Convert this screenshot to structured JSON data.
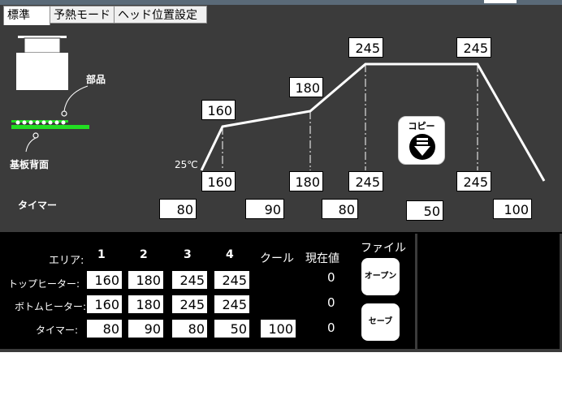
{
  "tabs": [
    {
      "label": "標準"
    },
    {
      "label": "予熱モード"
    },
    {
      "label": "ヘッド位置設定"
    }
  ],
  "graph": {
    "part_label": "部品",
    "board_label": "基板背面",
    "start_temp_label": "25℃",
    "timer_label": "タイマー",
    "top_temps": [
      "160",
      "180",
      "245",
      "245"
    ],
    "bottom_temps": [
      "160",
      "180",
      "245",
      "245"
    ],
    "timers": [
      "80",
      "90",
      "80",
      "50",
      "100"
    ],
    "copy_label": "コピー"
  },
  "table": {
    "area_label": "エリア:",
    "area_numbers": [
      "1",
      "2",
      "3",
      "4"
    ],
    "cool_label": "クール",
    "current_label": "現在値",
    "file_label": "ファイル",
    "top_heater_label": "トップヒーター:",
    "bottom_heater_label": "ボトムヒーター:",
    "timer_label": "タイマー:",
    "top_values": [
      "160",
      "180",
      "245",
      "245"
    ],
    "bottom_values": [
      "160",
      "180",
      "245",
      "245"
    ],
    "timer_values": [
      "80",
      "90",
      "80",
      "50"
    ],
    "cool_timer": "100",
    "current_top": "0",
    "current_bottom": "0",
    "current_timer": "0",
    "open_label": "オープン",
    "save_label": "セーブ"
  },
  "colors": {
    "panel": "#3b3b3b",
    "board": "#22dd22",
    "bottom_panel": "#000000"
  }
}
